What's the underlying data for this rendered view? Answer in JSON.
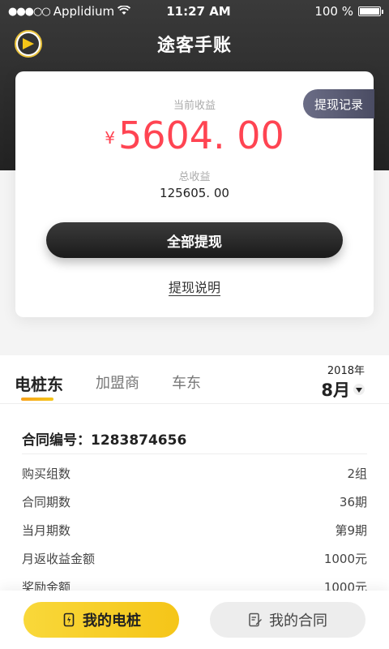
{
  "status_bar": {
    "signal": "●●●○○",
    "carrier": "Applidium",
    "time": "11:27 AM",
    "battery_text": "100 %"
  },
  "nav": {
    "title": "途客手账"
  },
  "earnings_card": {
    "record_tag": "提现记录",
    "current_label": "当前收益",
    "currency": "¥",
    "current_amount": "5604. 00",
    "total_label": "总收益",
    "total_amount": "125605. 00",
    "withdraw_button": "全部提现",
    "explain_link": "提现说明"
  },
  "tabs": {
    "items": [
      {
        "label": "电桩东",
        "active": true
      },
      {
        "label": "加盟商",
        "active": false
      },
      {
        "label": "车东",
        "active": false
      }
    ],
    "year": "2018年",
    "month": "8月"
  },
  "contract": {
    "label": "合同编号：1283874656",
    "rows": [
      {
        "label": "购买组数",
        "value": "2组"
      },
      {
        "label": "合同期数",
        "value": "36期"
      },
      {
        "label": "当月期数",
        "value": "第9期"
      },
      {
        "label": "月返收益金额",
        "value": "1000元"
      },
      {
        "label": "奖励金额",
        "value": "1000元"
      }
    ]
  },
  "bottom_nav": {
    "my_pile": "我的电桩",
    "my_contract": "我的合同"
  },
  "colors": {
    "accent_red": "#ff4452",
    "accent_yellow": "#f5c518",
    "dark": "#222222"
  }
}
